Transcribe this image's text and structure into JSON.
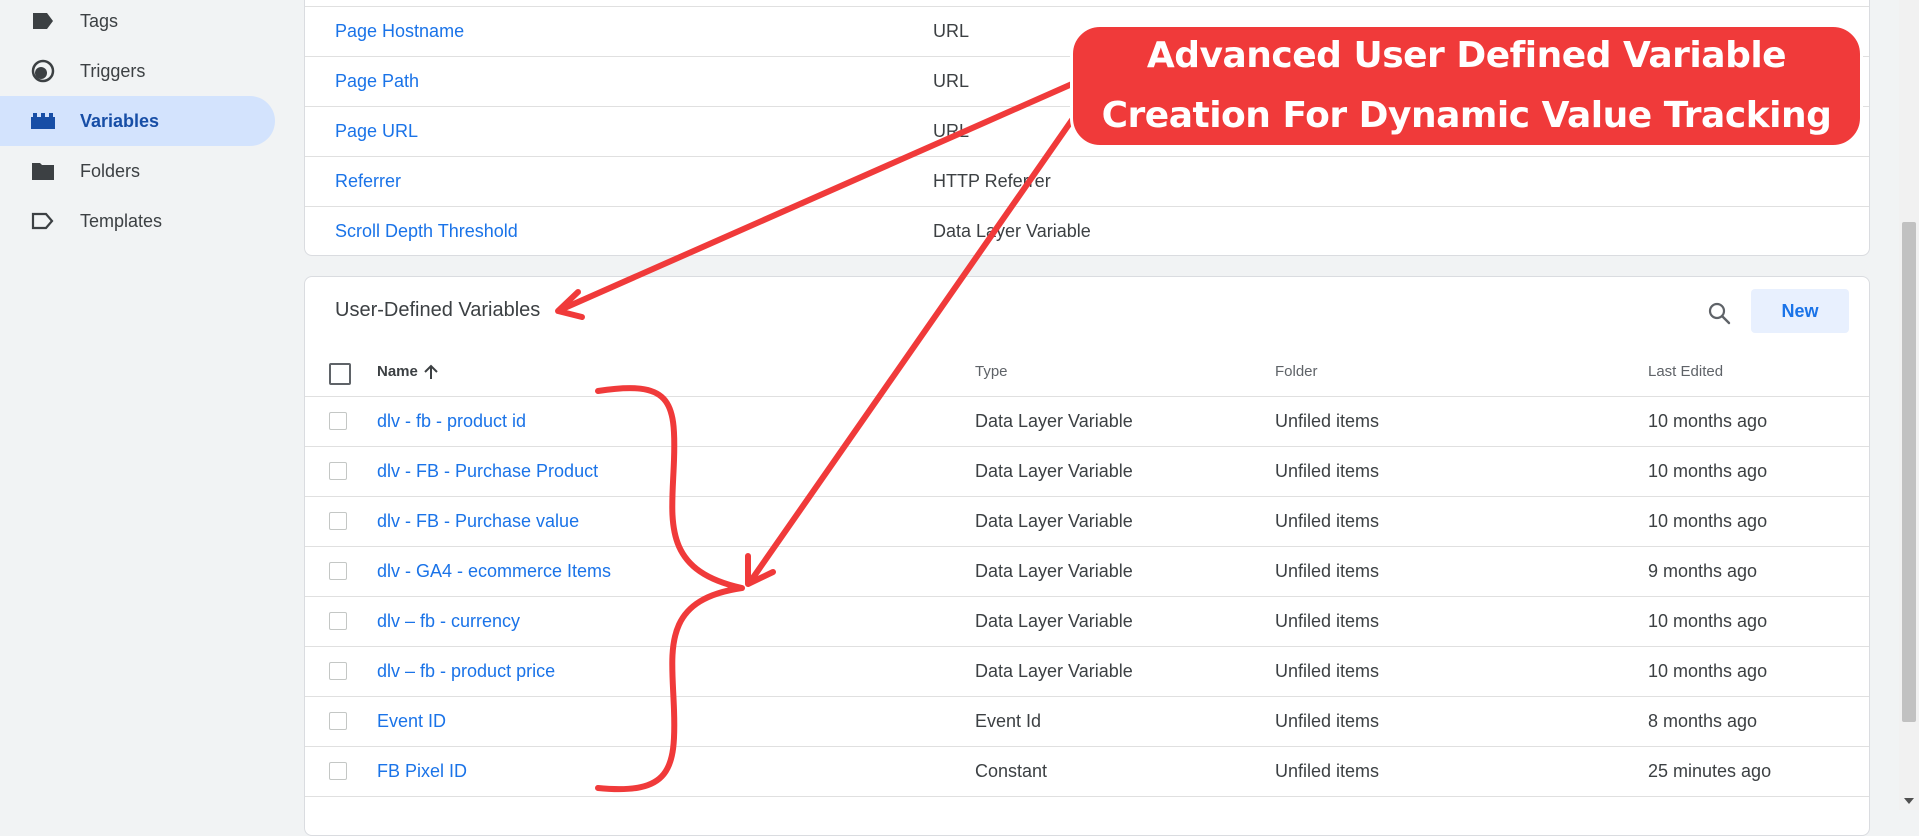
{
  "sidebar": {
    "items": [
      {
        "label": "Tags",
        "icon": "tag-icon",
        "active": false
      },
      {
        "label": "Triggers",
        "icon": "trigger-icon",
        "active": false
      },
      {
        "label": "Variables",
        "icon": "variables-icon",
        "active": true
      },
      {
        "label": "Folders",
        "icon": "folder-icon",
        "active": false
      },
      {
        "label": "Templates",
        "icon": "template-icon",
        "active": false
      }
    ]
  },
  "builtin_variables": {
    "rows": [
      {
        "name": "Page Hostname",
        "type": "URL"
      },
      {
        "name": "Page Path",
        "type": "URL"
      },
      {
        "name": "Page URL",
        "type": "URL"
      },
      {
        "name": "Referrer",
        "type": "HTTP Referrer"
      },
      {
        "name": "Scroll Depth Threshold",
        "type": "Data Layer Variable"
      }
    ]
  },
  "user_defined": {
    "title": "User-Defined Variables",
    "new_label": "New",
    "search_icon": "search-icon",
    "columns": {
      "name": "Name",
      "type": "Type",
      "folder": "Folder",
      "last_edited": "Last Edited"
    },
    "sort_icon": "arrow-up-icon",
    "rows": [
      {
        "name": "dlv - fb - product id",
        "type": "Data Layer Variable",
        "folder": "Unfiled items",
        "last_edited": "10 months ago"
      },
      {
        "name": "dlv - FB - Purchase Product",
        "type": "Data Layer Variable",
        "folder": "Unfiled items",
        "last_edited": "10 months ago"
      },
      {
        "name": "dlv - FB - Purchase value",
        "type": "Data Layer Variable",
        "folder": "Unfiled items",
        "last_edited": "10 months ago"
      },
      {
        "name": "dlv - GA4 - ecommerce Items",
        "type": "Data Layer Variable",
        "folder": "Unfiled items",
        "last_edited": "9 months ago"
      },
      {
        "name": "dlv – fb - currency",
        "type": "Data Layer Variable",
        "folder": "Unfiled items",
        "last_edited": "10 months ago"
      },
      {
        "name": "dlv – fb - product price",
        "type": "Data Layer Variable",
        "folder": "Unfiled items",
        "last_edited": "10 months ago"
      },
      {
        "name": "Event ID",
        "type": "Event Id",
        "folder": "Unfiled items",
        "last_edited": "8 months ago"
      },
      {
        "name": "FB Pixel ID",
        "type": "Constant",
        "folder": "Unfiled items",
        "last_edited": "25 minutes ago"
      }
    ]
  },
  "annotation": {
    "line1": "Advanced User Defined Variable",
    "line2": "Creation For Dynamic Value Tracking",
    "color": "#f03a3a"
  },
  "colors": {
    "link": "#1a73e8",
    "active_nav_bg": "#d3e3fd",
    "active_nav_text": "#174ea6",
    "new_button_bg": "#e8f0fe"
  }
}
